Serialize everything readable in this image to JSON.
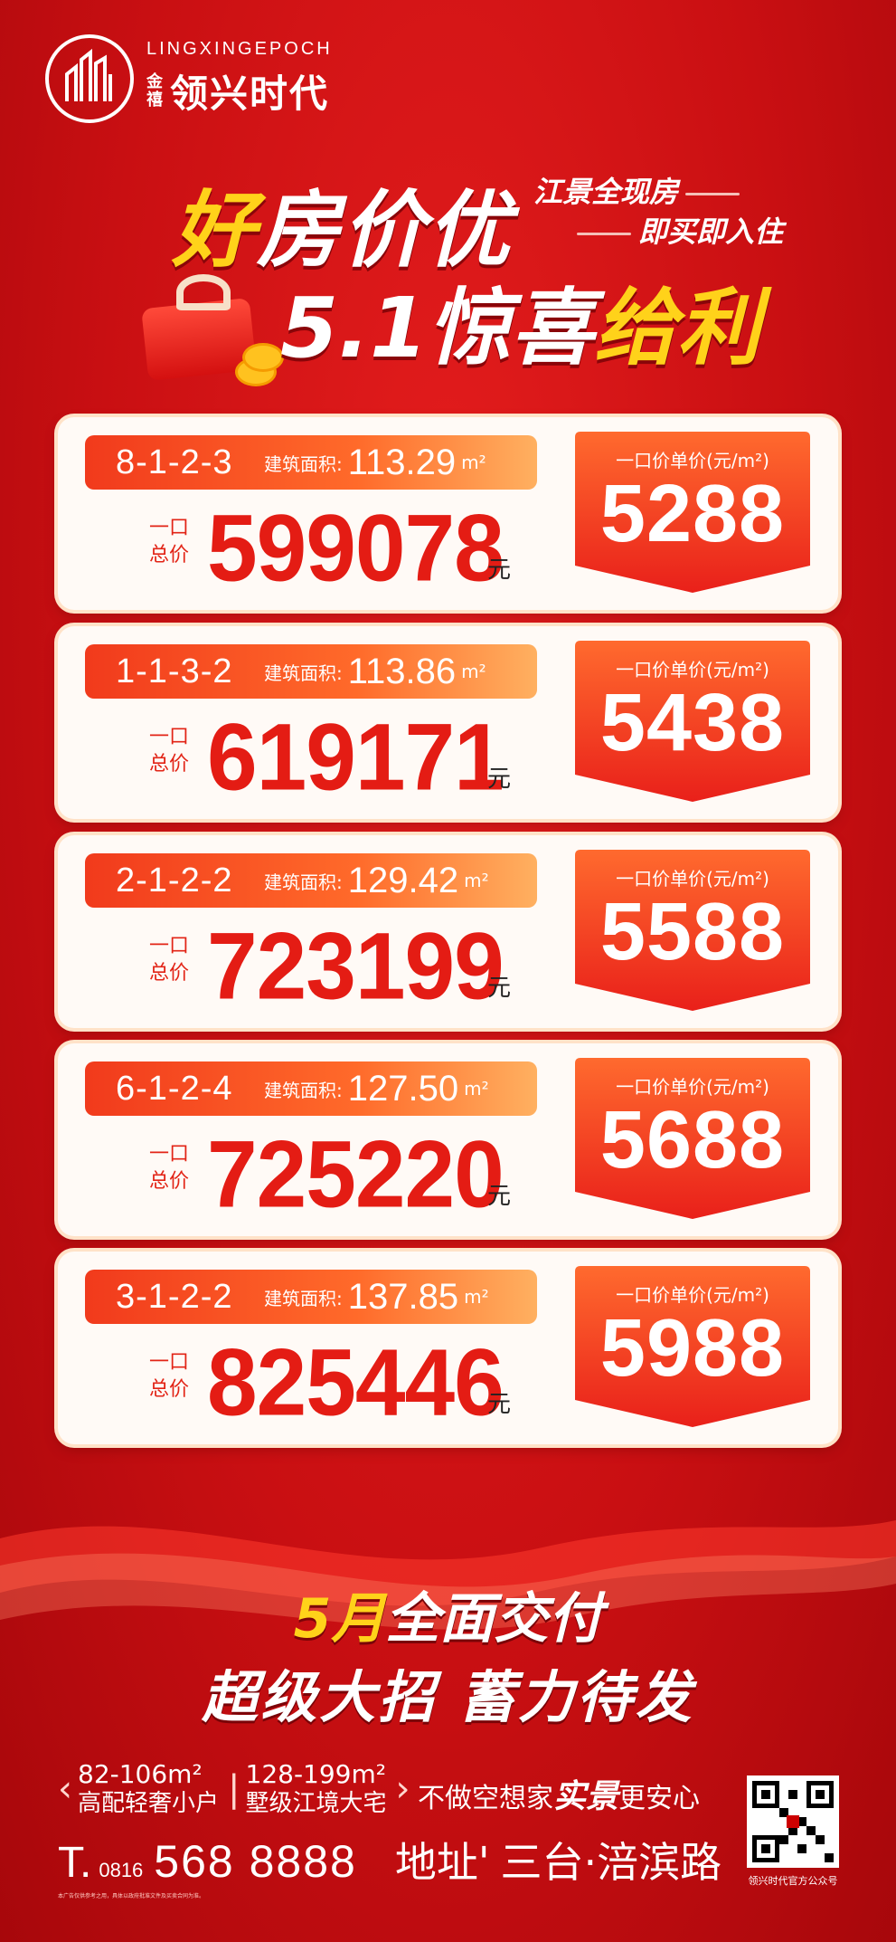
{
  "brand": {
    "en": "LINGXINGEPOCH",
    "small": "金禧",
    "cn": "领兴时代"
  },
  "headline": {
    "line1_gold": "好",
    "line1_rest": "房价优",
    "tag1_prefix": "江景",
    "tag1_bold": "全现房",
    "tag2": "即买即入住",
    "line2_white": "5.1惊喜",
    "line2_gold": "给利"
  },
  "units": [
    {
      "unit": "8-1-2-3",
      "area_label": "建筑面积:",
      "area": "113.29",
      "area_unit": "m²",
      "total_label_1": "一口",
      "total_label_2": "总价",
      "total": "599078",
      "yuan": "元",
      "price_label": "一口价单价(元/m²)",
      "price": "5288"
    },
    {
      "unit": "1-1-3-2",
      "area_label": "建筑面积:",
      "area": "113.86",
      "area_unit": "m²",
      "total_label_1": "一口",
      "total_label_2": "总价",
      "total": "619171",
      "yuan": "元",
      "price_label": "一口价单价(元/m²)",
      "price": "5438"
    },
    {
      "unit": "2-1-2-2",
      "area_label": "建筑面积:",
      "area": "129.42",
      "area_unit": "m²",
      "total_label_1": "一口",
      "total_label_2": "总价",
      "total": "723199",
      "yuan": "元",
      "price_label": "一口价单价(元/m²)",
      "price": "5588"
    },
    {
      "unit": "6-1-2-4",
      "area_label": "建筑面积:",
      "area": "127.50",
      "area_unit": "m²",
      "total_label_1": "一口",
      "total_label_2": "总价",
      "total": "725220",
      "yuan": "元",
      "price_label": "一口价单价(元/m²)",
      "price": "5688"
    },
    {
      "unit": "3-1-2-2",
      "area_label": "建筑面积:",
      "area": "137.85",
      "area_unit": "m²",
      "total_label_1": "一口",
      "total_label_2": "总价",
      "total": "825446",
      "yuan": "元",
      "price_label": "一口价单价(元/m²)",
      "price": "5988"
    }
  ],
  "slogans": {
    "line1_gold": "5月",
    "line1_rest": "全面交付",
    "line2": "超级大招  蓄力待发"
  },
  "features": [
    {
      "size": "82-106m²",
      "desc": "高配轻奢小户"
    },
    {
      "size": "128-199m²",
      "desc": "墅级江境大宅"
    }
  ],
  "promise": {
    "pre": "不做空想家",
    "hand": "实景",
    "post": "更安心"
  },
  "contact": {
    "t": "T.",
    "area_code": "0816",
    "phone": "568 8888",
    "addr_label": "地址'",
    "addr": "三台·涪滨路"
  },
  "legal": "本广告仅供参考之用，具体以政府批准文件及买卖合同为准。",
  "qr_caption": "领兴时代官方公众号",
  "colors": {
    "bg": "#d01215",
    "accent_gold": "#ffd21a",
    "price_red": "#e41c14"
  }
}
